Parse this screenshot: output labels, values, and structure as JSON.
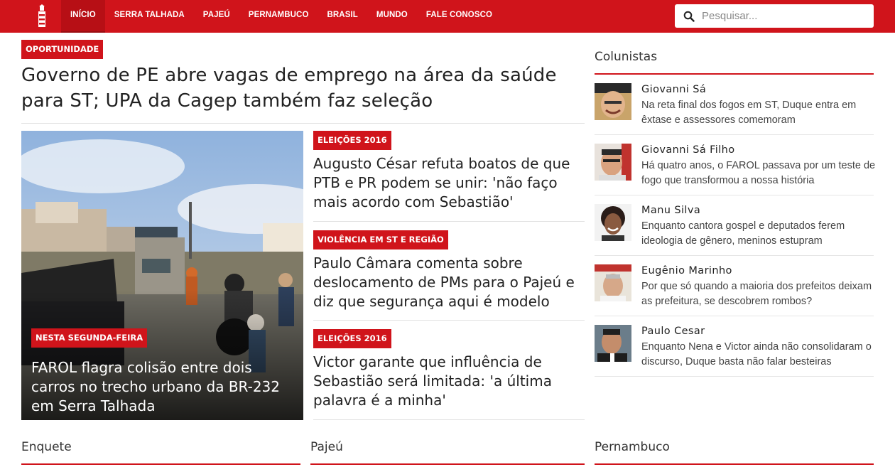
{
  "nav": {
    "logo_alt": "Farol de Notícias",
    "items": [
      "INÍCIO",
      "SERRA TALHADA",
      "PAJEÚ",
      "PERNAMBUCO",
      "BRASIL",
      "MUNDO",
      "FALE CONOSCO"
    ],
    "active": "INÍCIO"
  },
  "search": {
    "placeholder": "Pesquisar..."
  },
  "lead": {
    "tag": "OPORTUNIDADE",
    "headline": "Governo de PE abre vagas de emprego na área da saúde para ST; UPA da Cagep também faz seleção"
  },
  "feature": {
    "tag": "NESTA SEGUNDA-FEIRA",
    "title": "FAROL flagra colisão entre dois carros no trecho urbano da BR-232 em Serra Talhada"
  },
  "stories": [
    {
      "tag": "ELEIÇÕES 2016",
      "title": "Augusto César refuta boatos de que PTB e PR podem se unir: 'não faço mais acordo com Sebastião'"
    },
    {
      "tag": "VIOLÊNCIA EM ST E REGIÃO",
      "title": "Paulo Câmara comenta sobre deslocamento de PMs para o Pajeú e diz que segurança aqui é modelo"
    },
    {
      "tag": "ELEIÇÕES 2016",
      "title": "Victor garante que influência de Sebastião será limitada: 'a última palavra é a minha'"
    }
  ],
  "columnists": {
    "title": "Colunistas",
    "items": [
      {
        "name": "Giovanni Sá",
        "text": "Na reta final dos fogos em ST, Duque entra em êxtase e assessores comemoram"
      },
      {
        "name": "Giovanni Sá Filho",
        "text": "Há quatro anos, o FAROL passava por um teste de fogo que transformou a nossa história"
      },
      {
        "name": "Manu Silva",
        "text": "Enquanto cantora gospel e deputados ferem ideologia de gênero, meninos estupram"
      },
      {
        "name": "Eugênio Marinho",
        "text": "Por que só quando a maioria dos prefeitos deixam as prefeitura, se descobrem rombos?"
      },
      {
        "name": "Paulo Cesar",
        "text": "Enquanto Nena e Victor ainda não consolidaram o discurso, Duque basta não falar besteiras"
      }
    ]
  },
  "sections": {
    "enquete": "Enquete",
    "pajeu": "Pajeú",
    "pernambuco": "Pernambuco"
  },
  "colors": {
    "brand": "#d0141b",
    "nav_active": "#b70f15"
  }
}
